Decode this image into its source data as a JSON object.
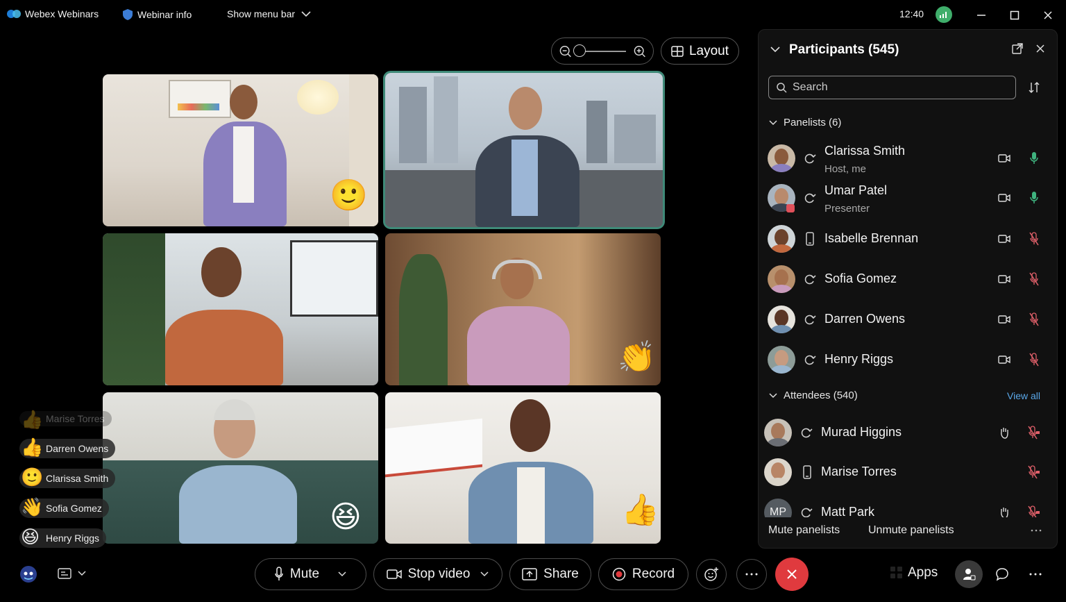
{
  "titlebar": {
    "app_name": "Webex Webinars",
    "webinar_info": "Webinar info",
    "show_menu_bar": "Show menu bar",
    "time": "12:40"
  },
  "layout_button": "Layout",
  "reactions_feed": [
    {
      "emoji": "👍",
      "name": "Marise Torres"
    },
    {
      "emoji": "👍",
      "name": "Darren Owens"
    },
    {
      "emoji": "🙂",
      "name": "Clarissa Smith"
    },
    {
      "emoji": "👋",
      "name": "Sofia Gomez"
    },
    {
      "emoji": "😆",
      "name": "Henry Riggs"
    }
  ],
  "tile_reactions": [
    "🙂",
    "👏",
    "😆",
    "👍"
  ],
  "participants": {
    "title": "Participants (545)",
    "search_placeholder": "Search",
    "panelists_label": "Panelists (6)",
    "attendees_label": "Attendees (540)",
    "view_all": "View all",
    "panelists": [
      {
        "name": "Clarissa Smith",
        "role": "Host, me"
      },
      {
        "name": "Umar Patel",
        "role": "Presenter"
      },
      {
        "name": "Isabelle Brennan",
        "role": ""
      },
      {
        "name": "Sofia Gomez",
        "role": ""
      },
      {
        "name": "Darren Owens",
        "role": ""
      },
      {
        "name": "Henry Riggs",
        "role": ""
      }
    ],
    "attendees": [
      {
        "name": "Murad Higgins",
        "initials": ""
      },
      {
        "name": "Marise Torres",
        "initials": ""
      },
      {
        "name": "Matt Park",
        "initials": "MP"
      }
    ],
    "mute_panelists": "Mute panelists",
    "unmute_panelists": "Unmute panelists"
  },
  "controls": {
    "mute": "Mute",
    "stop_video": "Stop video",
    "share": "Share",
    "record": "Record",
    "apps": "Apps"
  },
  "colors": {
    "active_speaker": "#3f8a78",
    "end_call": "#e03a3e",
    "link": "#5aa7e8",
    "mic_on": "#3fb37f",
    "mic_muted": "#e0606a"
  }
}
